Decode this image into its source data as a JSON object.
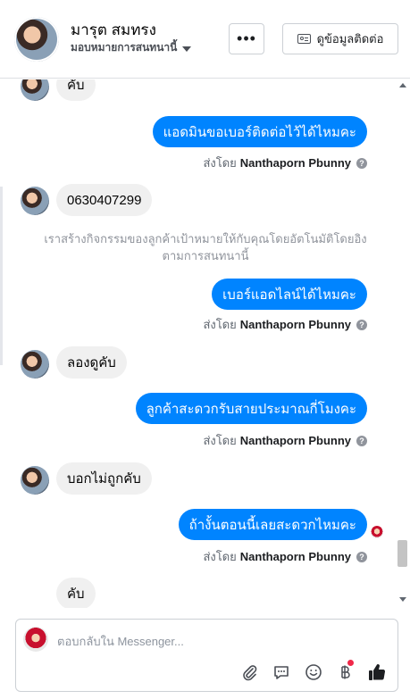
{
  "header": {
    "contact_name": "มารุต สมทรง",
    "assign_label": "มอบหมายการสนทนานี้",
    "more_label": "•••",
    "view_contact_label": "ดูข้อมูลติดต่อ"
  },
  "thread": {
    "messages": [
      {
        "text": "คับ"
      },
      {
        "text": "แอดมินขอเบอร์ติดต่อไว้ได้ไหมคะ"
      },
      {
        "text": "0630407299"
      },
      {
        "text": "ลองดูคับ"
      },
      {
        "text": "เบอร์แอดไลน์ได้ไหมคะ"
      },
      {
        "text": "ลูกค้าสะดวกรับสายประมาณกี่โมงคะ"
      },
      {
        "text": "บอกไม่ถูกคับ"
      },
      {
        "text": "ถ้างั้นตอนนี้เลยสะดวกไหมคะ"
      },
      {
        "text": "คับ"
      }
    ],
    "sent_by_prefix": "ส่งโดย",
    "sent_by_name": "Nanthaporn Pbunny",
    "help_glyph": "?",
    "system_note_line1": "เราสร้างกิจกรรมของลูกค้าเป้าหมายให้กับคุณโดยอัตโนมัติโดยอิง",
    "system_note_line2": "ตามการสนทนานี้"
  },
  "composer": {
    "placeholder": "ตอบกลับใน Messenger..."
  },
  "colors": {
    "outgoing_bubble": "#0084ff",
    "incoming_bubble": "#f0f0f0",
    "like_icon": "#1c1e21",
    "notification_dot": "#f02849"
  },
  "icons": [
    "more-icon",
    "contact-card-icon",
    "caret-down-icon",
    "help-icon",
    "paperclip-icon",
    "chat-bubble-icon",
    "smiley-icon",
    "baht-icon",
    "thumbs-up-icon"
  ]
}
